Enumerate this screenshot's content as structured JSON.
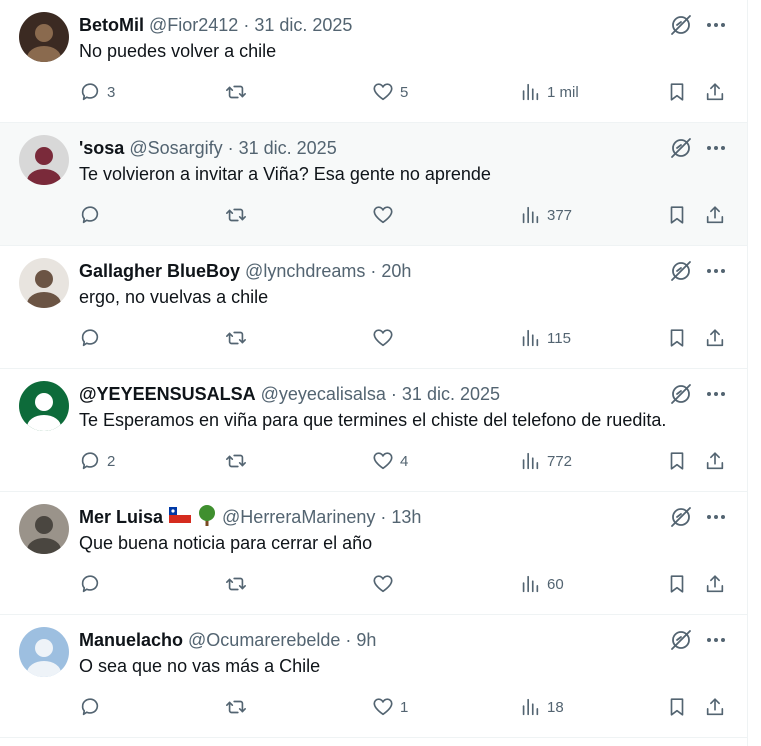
{
  "tweets": [
    {
      "name": "BetoMil",
      "handle": "@Fior2412",
      "date": "31 dic. 2025",
      "text": "No puedes volver a chile",
      "replies": "3",
      "retweets": "",
      "likes": "5",
      "views": "1 mil",
      "avatar_colors": [
        "#3b2a22",
        "#8a6a4e"
      ]
    },
    {
      "name": "'sosa",
      "handle": "@Sosargify",
      "date": "31 dic. 2025",
      "text": "Te volvieron a invitar a Viña? Esa gente no aprende",
      "replies": "",
      "retweets": "",
      "likes": "",
      "views": "377",
      "avatar_colors": [
        "#d8d8d8",
        "#7a2a3a"
      ]
    },
    {
      "name": "Gallagher BlueBoy",
      "handle": "@lynchdreams",
      "date": "20h",
      "text": "ergo, no vuelvas a chile",
      "replies": "",
      "retweets": "",
      "likes": "",
      "views": "115",
      "avatar_colors": [
        "#e8e4df",
        "#6b5444"
      ]
    },
    {
      "name": "@YEYEENSUSALSA",
      "handle": "@yeyecalisalsa",
      "date": "31 dic. 2025",
      "text": "Te Esperamos en viña para que termines el chiste del telefono de ruedita.",
      "replies": "2",
      "retweets": "",
      "likes": "4",
      "views": "772",
      "avatar_colors": [
        "#0d6b3a",
        "#ffffff"
      ]
    },
    {
      "name": "Mer Luisa",
      "handle": "@HerreraMarineny",
      "date": "13h",
      "text": "Que buena noticia para cerrar el año",
      "replies": "",
      "retweets": "",
      "likes": "",
      "views": "60",
      "avatar_colors": [
        "#9a938a",
        "#4a4640"
      ],
      "emojis": [
        "chile-flag",
        "tree"
      ]
    },
    {
      "name": "Manuelacho",
      "handle": "@Ocumarerebelde",
      "date": "9h",
      "text": "O sea que no vas más a Chile",
      "replies": "",
      "retweets": "",
      "likes": "1",
      "views": "18",
      "avatar_colors": [
        "#9dbfe0",
        "#eef3f8"
      ]
    }
  ],
  "icons": {
    "reply": "reply-icon",
    "retweet": "retweet-icon",
    "like": "heart-icon",
    "views": "views-icon",
    "bookmark": "bookmark-icon",
    "share": "share-icon",
    "grok": "grok-icon",
    "more": "more-icon"
  },
  "colors": {
    "text": "#0f1419",
    "muted": "#536471",
    "divider": "#eff3f4",
    "hover_bg": "#f7f9f9"
  }
}
